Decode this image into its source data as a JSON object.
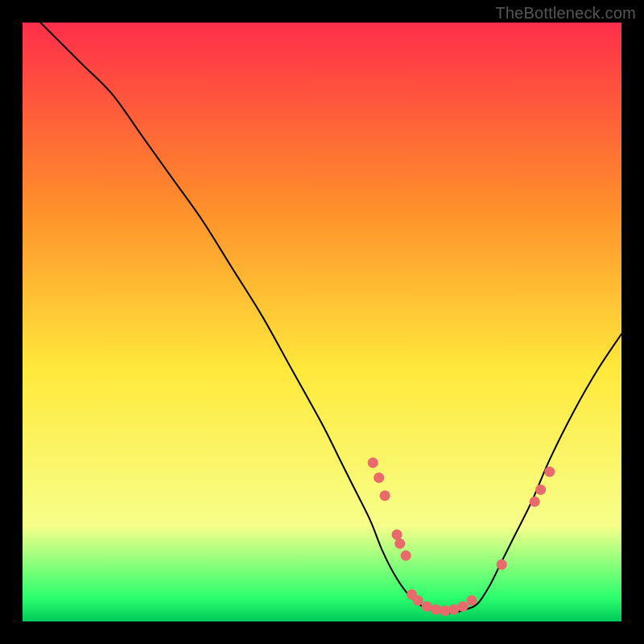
{
  "watermark": "TheBottleneck.com",
  "colors": {
    "frame": "#000000",
    "curve": "#000000",
    "dots": "#e86a6a",
    "gradient_top": "#ff2e4a",
    "gradient_mid1": "#ff8c2b",
    "gradient_mid2": "#ffe93b",
    "gradient_bottom1": "#f7ff8a",
    "gradient_bottom2": "#2bff6e",
    "gradient_bottom3": "#00c958"
  },
  "chart_data": {
    "type": "line",
    "title": "",
    "xlabel": "",
    "ylabel": "",
    "xlim": [
      0,
      100
    ],
    "ylim": [
      0,
      100
    ],
    "series": [
      {
        "name": "curve",
        "x": [
          3,
          6,
          10,
          15,
          20,
          25,
          30,
          35,
          40,
          45,
          50,
          53,
          55,
          58,
          60,
          62,
          64,
          66,
          68,
          70,
          72,
          74,
          76,
          78,
          80,
          82,
          85,
          88,
          92,
          96,
          100
        ],
        "y": [
          100,
          97,
          93,
          88,
          81,
          74,
          67,
          59,
          51,
          42,
          33,
          27,
          23,
          17,
          12,
          8,
          5,
          3,
          2,
          1.5,
          1.5,
          2,
          3,
          6,
          10,
          14,
          20,
          27,
          35,
          42,
          48
        ]
      }
    ],
    "dots": [
      {
        "x": 58.5,
        "y": 26.5
      },
      {
        "x": 59.5,
        "y": 24.0
      },
      {
        "x": 60.5,
        "y": 21.0
      },
      {
        "x": 62.5,
        "y": 14.5
      },
      {
        "x": 63.0,
        "y": 13.0
      },
      {
        "x": 64.0,
        "y": 11.0
      },
      {
        "x": 65.0,
        "y": 4.5
      },
      {
        "x": 66.0,
        "y": 3.5
      },
      {
        "x": 67.5,
        "y": 2.5
      },
      {
        "x": 69.0,
        "y": 2.0
      },
      {
        "x": 70.5,
        "y": 1.8
      },
      {
        "x": 72.0,
        "y": 2.0
      },
      {
        "x": 73.5,
        "y": 2.5
      },
      {
        "x": 75.0,
        "y": 3.5
      },
      {
        "x": 80.0,
        "y": 9.5
      },
      {
        "x": 85.5,
        "y": 20.0
      },
      {
        "x": 86.5,
        "y": 22.0
      },
      {
        "x": 88.0,
        "y": 25.0
      }
    ]
  }
}
